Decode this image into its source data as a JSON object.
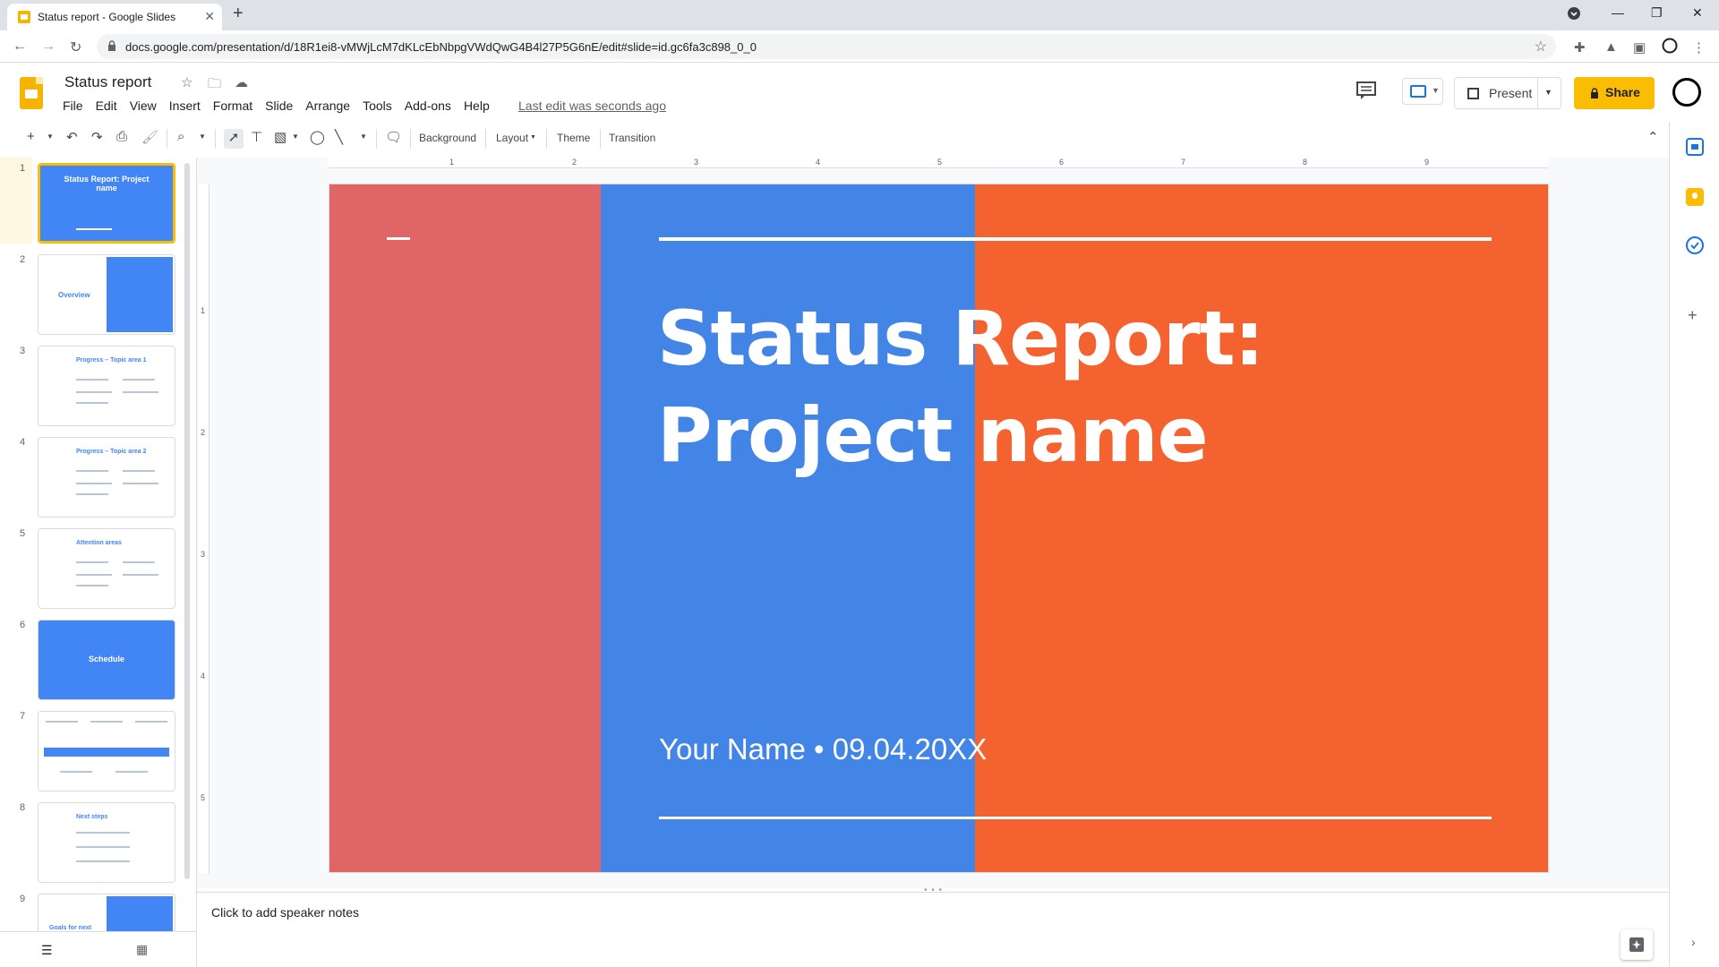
{
  "browser": {
    "tab_title": "Status report - Google Slides",
    "url": "docs.google.com/presentation/d/18R1ei8-vMWjLcM7dKLcEbNbpgVWdQwG4B4l27P5G6nE/edit#slide=id.gc6fa3c898_0_0"
  },
  "doc": {
    "title": "Status report",
    "last_edit": "Last edit was seconds ago",
    "menus": [
      "File",
      "Edit",
      "View",
      "Insert",
      "Format",
      "Slide",
      "Arrange",
      "Tools",
      "Add-ons",
      "Help"
    ],
    "present_label": "Present",
    "share_label": "Share"
  },
  "toolbar": {
    "background": "Background",
    "layout": "Layout",
    "theme": "Theme",
    "transition": "Transition"
  },
  "ruler": {
    "top": [
      "1",
      "2",
      "3",
      "4",
      "5",
      "6",
      "7",
      "8",
      "9"
    ],
    "left": [
      "1",
      "2",
      "3",
      "4",
      "5"
    ]
  },
  "filmstrip": {
    "numbers": [
      "1",
      "2",
      "3",
      "4",
      "5",
      "6",
      "7",
      "8",
      "9"
    ],
    "slide1_title": "Status Report: Project name",
    "slide2_title": "Overview",
    "slide3_title": "Progress – Topic area 1",
    "slide4_title": "Progress – Topic area 2",
    "slide5_title": "Attention areas",
    "slide6_title": "Schedule",
    "slide8_title": "Next steps",
    "slide9_title": "Goals for next"
  },
  "slide": {
    "title_line1": "Status Report:",
    "title_line2": "Project name",
    "subtitle": "Your Name • 09.04.20XX",
    "colors": {
      "red": "#e06666",
      "blue": "#4285e6",
      "orange": "#f4632f"
    }
  },
  "notes": {
    "placeholder": "Click to add speaker notes"
  }
}
